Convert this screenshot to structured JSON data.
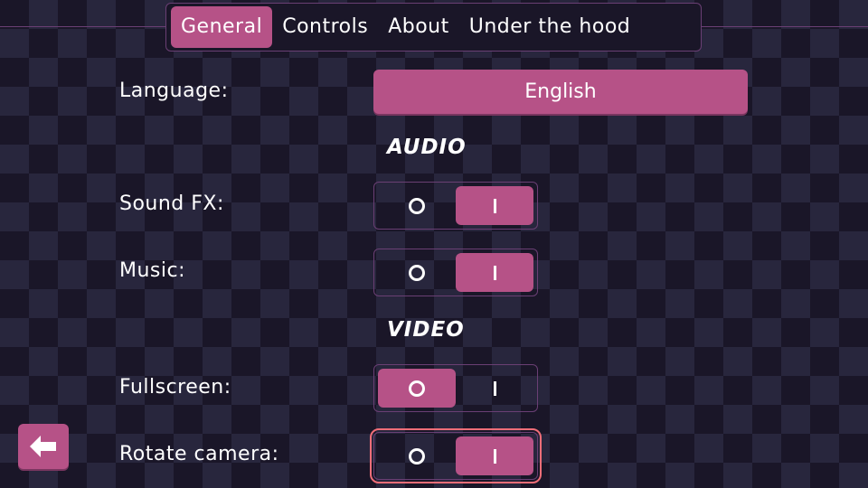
{
  "tabs": [
    {
      "label": "General",
      "active": true
    },
    {
      "label": "Controls"
    },
    {
      "label": "About"
    },
    {
      "label": "Under the hood"
    }
  ],
  "language": {
    "label": "Language:",
    "value": "English"
  },
  "sections": {
    "audio": "AUDIO",
    "video": "VIDEO"
  },
  "settings": [
    {
      "label": "Sound FX:",
      "value": "on"
    },
    {
      "label": "Music:",
      "value": "on"
    },
    {
      "label": "Fullscreen:",
      "value": "off"
    },
    {
      "label": "Rotate camera:",
      "value": "on",
      "focused": true
    }
  ],
  "back_button": {
    "icon": "arrow-left-icon"
  },
  "colors": {
    "accent": "#b65287",
    "focus": "#f06e78",
    "border": "#6a3f74",
    "background": "#1a1628"
  }
}
